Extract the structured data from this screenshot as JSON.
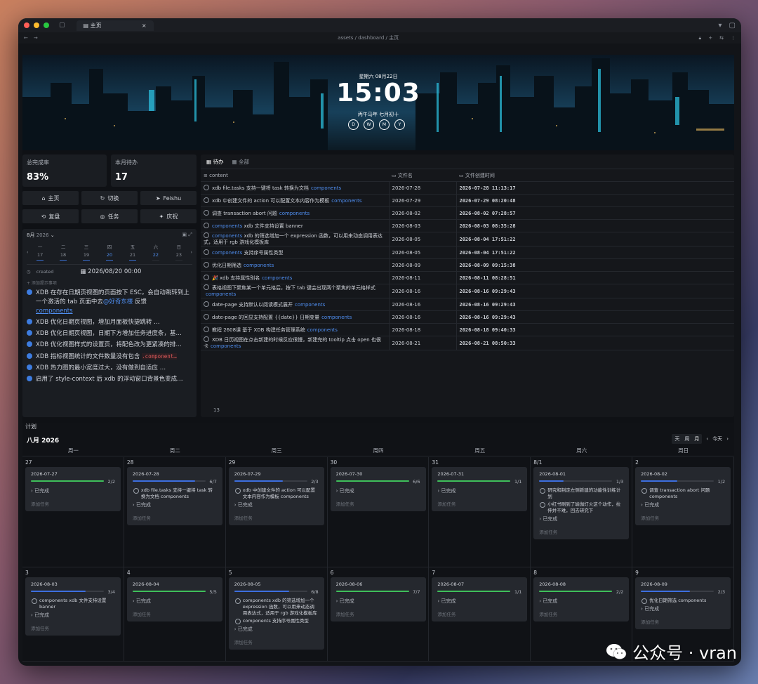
{
  "window": {
    "tab_title": "主页",
    "breadcrumb": "assets / dashboard / 主页"
  },
  "banner": {
    "date": "星期六 08月22日",
    "time": "15:03",
    "lunar": "丙午马年 七月初十",
    "buttons": [
      "D",
      "W",
      "M",
      "Y"
    ]
  },
  "stats": {
    "completion_label": "总完成率",
    "completion_value": "83%",
    "monthly_label": "本月待办",
    "monthly_value": "17"
  },
  "quick_buttons": {
    "home": "主页",
    "switch": "切换",
    "feishu": "Feishu",
    "review": "复盘",
    "tasks": "任务",
    "celebrate": "庆祝"
  },
  "mini_cal": {
    "month_label": "8月",
    "year_label": "2026",
    "days": [
      {
        "w": "一",
        "d": "17"
      },
      {
        "w": "二",
        "d": "18"
      },
      {
        "w": "三",
        "d": "19"
      },
      {
        "w": "四",
        "d": "20"
      },
      {
        "w": "五",
        "d": "21"
      },
      {
        "w": "六",
        "d": "22"
      },
      {
        "w": "日",
        "d": "23"
      }
    ],
    "created_label": "created",
    "created_value": "2026/08/20 00:00",
    "add_label": "+ 添加提示事项"
  },
  "task_list": [
    {
      "text": "XDB 在存在日期页视图的页面按下 ESC，会自动跳转到上一个激活的 tab 页面中去",
      "mention": "@好奇东楼",
      "tail": " 反馈",
      "tag": "components"
    },
    {
      "text": "XDB 优化日期页视图，增加月面板快捷跳转 …"
    },
    {
      "text": "XDB 优化日期页视图，日期下方增加任务进度条，基…"
    },
    {
      "text": "XDB 优化视图样式的设置页，将配色改为更紧凑的排…"
    },
    {
      "text": "XDB 指标视图统计的文件数量没有包含 ",
      "code": ".component…"
    },
    {
      "text": "XDB 热力图的最小宽度过大，没有做到自适应 …"
    },
    {
      "text": "启用了 style-context 后 xdb 的浮动窗口背景色变成…"
    }
  ],
  "todo_table": {
    "tabs": [
      "待办",
      "全部"
    ],
    "headers": [
      "content",
      "文件名",
      "文件创建时间"
    ],
    "rows": [
      {
        "content": "xdb file.tasks 支持一键将 task 转换为文档",
        "tag": "components",
        "file": "2026-07-28",
        "created": "2026-07-28 11:13:17"
      },
      {
        "content": "xdb 中创建文件的 action 可以配置文本内容作为模板",
        "tag": "components",
        "file": "2026-07-29",
        "created": "2026-07-29 08:20:48"
      },
      {
        "content": "调查 transaction abort 问题",
        "tag": "components",
        "file": "2026-08-02",
        "created": "2026-08-02 07:28:57"
      },
      {
        "pre_tag": "components",
        "content": " xdb 文件支持设置 banner",
        "file": "2026-08-03",
        "created": "2026-08-03 08:35:28"
      },
      {
        "pre_tag": "components",
        "content": " xdb 的筛选增加一个 expression 函数，可以用来动态调用表达式，适用于 rgb 游戏化模板库",
        "file": "2026-08-05",
        "created": "2026-08-04 17:51:22"
      },
      {
        "pre_tag": "components",
        "content": " 支持序号属性类型",
        "file": "2026-08-05",
        "created": "2026-08-04 17:51:22"
      },
      {
        "content": "优化日期筛选",
        "tag": "components",
        "file": "2026-08-09",
        "created": "2026-08-09 09:15:38"
      },
      {
        "content": "🎉 xdb 支持属性别名",
        "tag": "components",
        "file": "2026-08-11",
        "created": "2026-08-11 08:28:51"
      },
      {
        "content": "表格视图下聚焦某一个单元格后，按下 tab 键会出现两个聚焦的单元格样式",
        "tag": "components",
        "file": "2026-08-16",
        "created": "2026-08-16 09:29:43"
      },
      {
        "content": "date-page 支持默认以阅读模式展开",
        "tag": "components",
        "file": "2026-08-16",
        "created": "2026-08-16 09:29:43"
      },
      {
        "content": "date-page 的回显支持配置 {{date}} 日期变量",
        "tag": "components",
        "file": "2026-08-16",
        "created": "2026-08-16 09:29:43"
      },
      {
        "content": "教程 2608课 基于 XDB 构建任务管理系统",
        "tag": "components",
        "file": "2026-08-18",
        "created": "2026-08-18 09:40:33"
      },
      {
        "content": "XDB 日历视图在点击新建的时候反应很慢，新建完的 tooltip 点击 open 也很卡",
        "tag": "components",
        "file": "2026-08-21",
        "created": "2026-08-21 08:50:33"
      }
    ],
    "footer_count": "13"
  },
  "plan": {
    "section_title": "计划",
    "month_title": "八月 2026",
    "view_buttons": [
      "天",
      "周",
      "月"
    ],
    "today": "今天",
    "weekdays": [
      "周一",
      "周二",
      "周三",
      "周四",
      "周五",
      "周六",
      "周日"
    ],
    "done_label": "已完成",
    "add_label": "添加任务",
    "days": [
      {
        "num": "27",
        "date": "2026-07-27",
        "frac": "2/2",
        "progress": 1.0,
        "color": "#3fbf5a",
        "tasks": []
      },
      {
        "num": "28",
        "date": "2026-07-28",
        "frac": "6/7",
        "progress": 0.857,
        "color": "#3d6fe0",
        "tasks": [
          "xdb file.tasks 支持一键将 task 转换为文档 components"
        ]
      },
      {
        "num": "29",
        "date": "2026-07-29",
        "frac": "2/3",
        "progress": 0.667,
        "color": "#3d6fe0",
        "tasks": [
          "xdb 中创建文件的 action 可以配置文本内容作为模板 components"
        ]
      },
      {
        "num": "30",
        "date": "2026-07-30",
        "frac": "6/6",
        "progress": 1.0,
        "color": "#3fbf5a",
        "tasks": []
      },
      {
        "num": "31",
        "date": "2026-07-31",
        "frac": "1/1",
        "progress": 1.0,
        "color": "#3fbf5a",
        "tasks": []
      },
      {
        "num": "8/1",
        "date": "2026-08-01",
        "frac": "1/3",
        "progress": 0.333,
        "color": "#3d6fe0",
        "tasks": [
          "研究和制定左侧新建的功能性训练计划",
          "小红书刷到了瑜伽灯火这个动作，拉伸并不难，回去研究下"
        ]
      },
      {
        "num": "2",
        "date": "2026-08-02",
        "frac": "1/2",
        "progress": 0.5,
        "color": "#3d6fe0",
        "tasks": [
          "调查 transaction abort 问题 components"
        ]
      },
      {
        "num": "3",
        "date": "2026-08-03",
        "frac": "3/4",
        "progress": 0.75,
        "color": "#3d6fe0",
        "tasks": [
          "components xdb 文件支持设置 banner"
        ]
      },
      {
        "num": "4",
        "date": "2026-08-04",
        "frac": "5/5",
        "progress": 1.0,
        "color": "#3fbf5a",
        "tasks": []
      },
      {
        "num": "5",
        "date": "2026-08-05",
        "frac": "6/8",
        "progress": 0.75,
        "color": "#3d6fe0",
        "tasks": [
          "components xdb 的筛选增加一个 expression 函数，可以用来动态调用表达式，适用于 rgb 游戏化模板库",
          "components 支持序号属性类型"
        ]
      },
      {
        "num": "6",
        "date": "2026-08-06",
        "frac": "7/7",
        "progress": 1.0,
        "color": "#3fbf5a",
        "tasks": []
      },
      {
        "num": "7",
        "date": "2026-08-07",
        "frac": "1/1",
        "progress": 1.0,
        "color": "#3fbf5a",
        "tasks": []
      },
      {
        "num": "8",
        "date": "2026-08-08",
        "frac": "2/2",
        "progress": 1.0,
        "color": "#3fbf5a",
        "tasks": []
      },
      {
        "num": "9",
        "date": "2026-08-09",
        "frac": "2/3",
        "progress": 0.667,
        "color": "#3d6fe0",
        "tasks": [
          "优化日期筛选 components"
        ]
      }
    ]
  },
  "watermark": "公众号 · vran"
}
